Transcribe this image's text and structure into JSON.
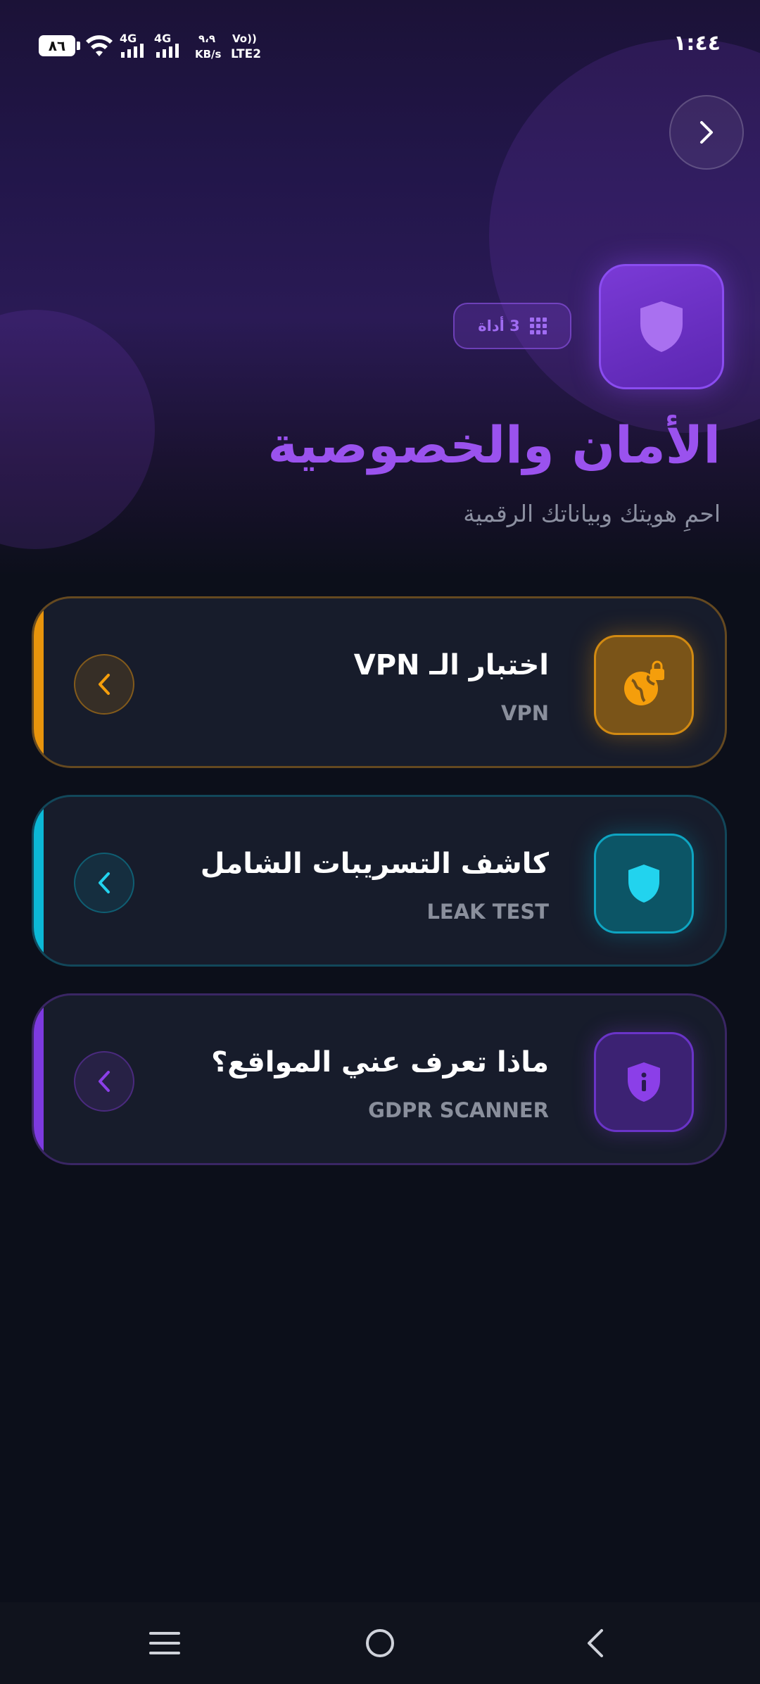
{
  "status_bar": {
    "battery": "٨٦",
    "net1": "4G",
    "net2": "4G",
    "speed_value": "٩،٩",
    "speed_unit": "KB/s",
    "volte": "Vo))",
    "lte": "LTE2",
    "time": "١:٤٤"
  },
  "hero": {
    "tools_count": "3 أداة",
    "title": "الأمان والخصوصية",
    "subtitle": "احمِ هويتك وبياناتك الرقمية",
    "accent_color": "#9a52ee"
  },
  "cards": [
    {
      "title": "اختبار الـ VPN",
      "subtitle": "VPN",
      "icon": "globe-lock-icon",
      "accent_color": "#f59e0b"
    },
    {
      "title": "كاشف التسريبات الشامل",
      "subtitle": "LEAK TEST",
      "icon": "shield-icon",
      "accent_color": "#06b6d4"
    },
    {
      "title": "ماذا تعرف عني المواقع؟",
      "subtitle": "GDPR SCANNER",
      "icon": "shield-info-icon",
      "accent_color": "#8b3fe8"
    }
  ],
  "nav": {
    "menu_icon": "menu-icon",
    "home_icon": "home-circle-icon",
    "back_icon": "back-chevron-icon"
  }
}
